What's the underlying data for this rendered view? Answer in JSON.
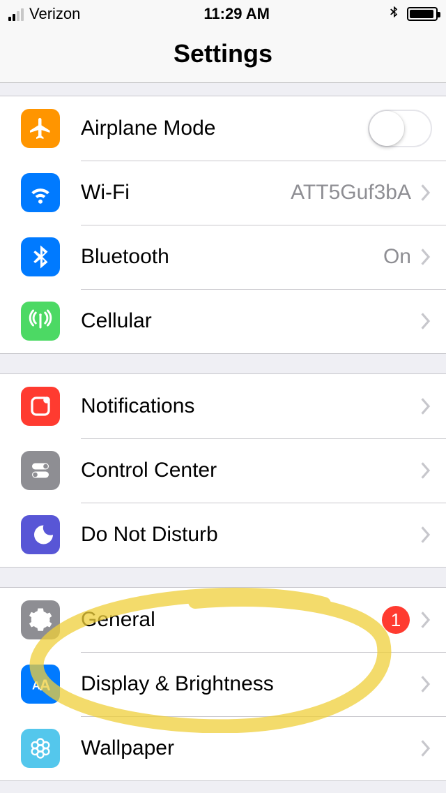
{
  "status": {
    "carrier": "Verizon",
    "time": "11:29 AM"
  },
  "title": "Settings",
  "groups": [
    {
      "rows": [
        {
          "key": "airplane",
          "label": "Airplane Mode",
          "toggle": false
        },
        {
          "key": "wifi",
          "label": "Wi-Fi",
          "detail": "ATT5Guf3bA",
          "chevron": true
        },
        {
          "key": "bluetooth",
          "label": "Bluetooth",
          "detail": "On",
          "chevron": true
        },
        {
          "key": "cellular",
          "label": "Cellular",
          "chevron": true
        }
      ]
    },
    {
      "rows": [
        {
          "key": "notifications",
          "label": "Notifications",
          "chevron": true
        },
        {
          "key": "controlcenter",
          "label": "Control Center",
          "chevron": true
        },
        {
          "key": "dnd",
          "label": "Do Not Disturb",
          "chevron": true
        }
      ]
    },
    {
      "rows": [
        {
          "key": "general",
          "label": "General",
          "badge": "1",
          "chevron": true
        },
        {
          "key": "display",
          "label": "Display & Brightness",
          "chevron": true
        },
        {
          "key": "wallpaper",
          "label": "Wallpaper",
          "chevron": true
        }
      ]
    }
  ],
  "annotation": {
    "color": "#efcf3a",
    "target": "general"
  }
}
